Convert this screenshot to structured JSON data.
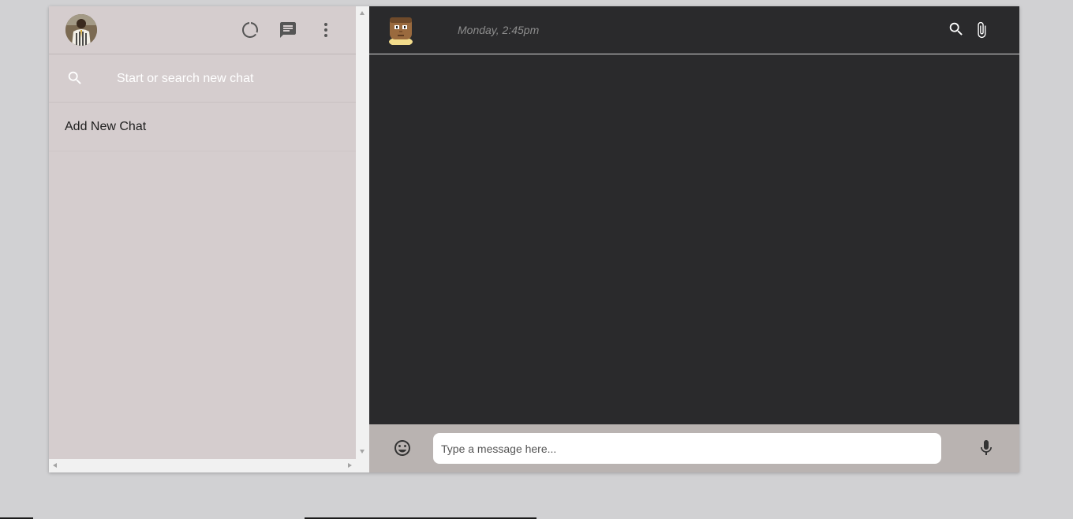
{
  "sidebar": {
    "avatar_alt": "user-profile-photo",
    "icons": [
      "status-icon",
      "new-chat-icon",
      "more-vert-icon"
    ],
    "search": {
      "placeholder": "Start or search new chat"
    },
    "add_chat_label": "Add New Chat"
  },
  "chat": {
    "contact_avatar": "pixel-face-avatar",
    "last_seen": "Monday, 2:45pm",
    "icons": [
      "search-icon",
      "attach-icon"
    ],
    "composer": {
      "placeholder": "Type a message here...",
      "icons": [
        "emoji-icon",
        "mic-icon"
      ]
    }
  },
  "colors": {
    "sidebar_bg": "#d5cdce",
    "chat_bg": "#2a2a2c",
    "composer_bg": "#b9b3b1",
    "page_bg": "#d1d1d3"
  }
}
